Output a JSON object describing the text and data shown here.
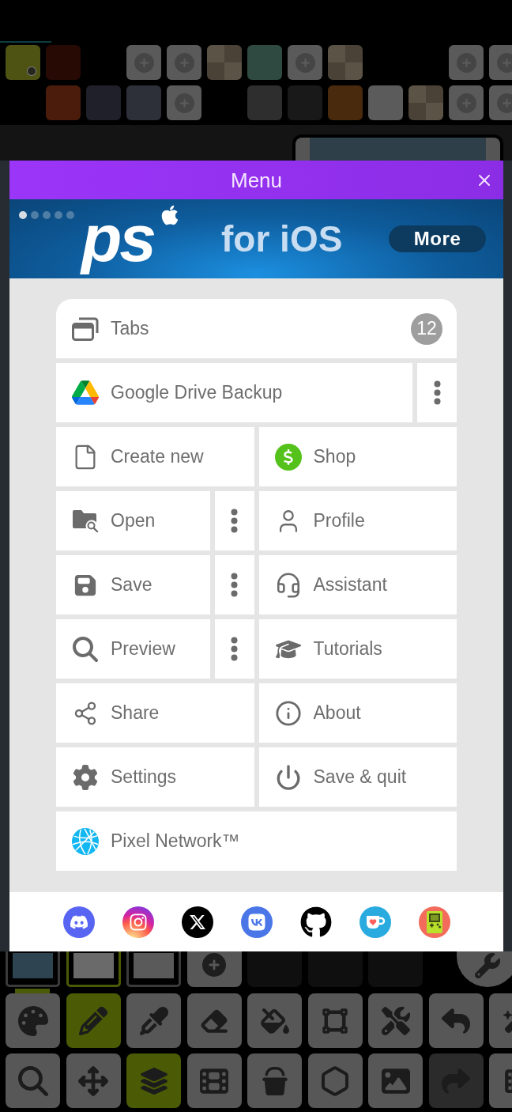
{
  "palette": [
    [
      {
        "kind": "color",
        "color": "#4e5314",
        "selected": true
      },
      {
        "kind": "color",
        "color": "#260a03",
        "selected": false
      },
      {
        "kind": "empty"
      },
      {
        "kind": "add"
      },
      {
        "kind": "add"
      },
      {
        "kind": "transparent",
        "selected": false
      },
      {
        "kind": "color",
        "color": "#2f4a41",
        "selected": false
      },
      {
        "kind": "add"
      },
      {
        "kind": "transparent",
        "selected": false
      },
      {
        "kind": "empty"
      },
      {
        "kind": "empty"
      },
      {
        "kind": "add"
      },
      {
        "kind": "add"
      }
    ],
    [
      {
        "kind": "empty"
      },
      {
        "kind": "color",
        "color": "#4b1c0b",
        "selected": false
      },
      {
        "kind": "color",
        "color": "#20202a",
        "selected": false
      },
      {
        "kind": "color",
        "color": "#2d3039",
        "selected": false
      },
      {
        "kind": "add"
      },
      {
        "kind": "empty"
      },
      {
        "kind": "color",
        "color": "#2e2e2e",
        "selected": false
      },
      {
        "kind": "color",
        "color": "#191919",
        "selected": false
      },
      {
        "kind": "color",
        "color": "#4a2a0c",
        "selected": false
      },
      {
        "kind": "color",
        "color": "#5b5b5b",
        "selected": false
      },
      {
        "kind": "transparent",
        "selected": false
      },
      {
        "kind": "add"
      },
      {
        "kind": "add"
      }
    ]
  ],
  "modal": {
    "title": "Menu",
    "banner": {
      "slides": [
        {
          "selected": true
        },
        {
          "selected": false
        },
        {
          "selected": false
        },
        {
          "selected": false
        },
        {
          "selected": false
        }
      ],
      "logo": "ps",
      "headline": "for iOS",
      "button": "More"
    },
    "menu": [
      [
        {
          "kind": "item",
          "label": "Tabs",
          "badge": "12"
        }
      ],
      [
        {
          "kind": "item",
          "label": "Google Drive Backup"
        },
        {
          "kind": "more"
        }
      ],
      [
        {
          "kind": "item",
          "label": "Create new"
        },
        {
          "kind": "item",
          "label": "Shop"
        }
      ],
      [
        {
          "kind": "item",
          "label": "Open"
        },
        {
          "kind": "more"
        },
        {
          "kind": "item",
          "label": "Profile"
        }
      ],
      [
        {
          "kind": "item",
          "label": "Save"
        },
        {
          "kind": "more"
        },
        {
          "kind": "item",
          "label": "Assistant"
        }
      ],
      [
        {
          "kind": "item",
          "label": "Preview"
        },
        {
          "kind": "more"
        },
        {
          "kind": "item",
          "label": "Tutorials"
        }
      ],
      [
        {
          "kind": "item",
          "label": "Share"
        },
        {
          "kind": "item",
          "label": "About"
        }
      ],
      [
        {
          "kind": "item",
          "label": "Settings"
        },
        {
          "kind": "item",
          "label": "Save & quit"
        }
      ],
      [
        {
          "kind": "item",
          "label": "Pixel Network™"
        }
      ]
    ]
  },
  "frames": [
    {
      "selected": false
    },
    {
      "selected": true
    },
    {
      "selected": false
    }
  ],
  "tools": [
    [
      {
        "selected": false,
        "disabled": false
      },
      {
        "selected": true,
        "disabled": false
      },
      {
        "selected": false,
        "disabled": false
      },
      {
        "selected": false,
        "disabled": false
      },
      {
        "selected": false,
        "disabled": false
      },
      {
        "selected": false,
        "disabled": false
      },
      {
        "selected": false,
        "disabled": false
      },
      {
        "selected": false,
        "disabled": false
      },
      {
        "selected": false,
        "disabled": false
      }
    ],
    [
      {
        "selected": false,
        "disabled": false
      },
      {
        "selected": false,
        "disabled": false
      },
      {
        "selected": true,
        "disabled": false
      },
      {
        "selected": false,
        "disabled": false
      },
      {
        "selected": false,
        "disabled": false
      },
      {
        "selected": false,
        "disabled": false
      },
      {
        "selected": false,
        "disabled": false
      },
      {
        "selected": false,
        "disabled": true
      },
      {
        "selected": false,
        "disabled": false
      }
    ]
  ]
}
